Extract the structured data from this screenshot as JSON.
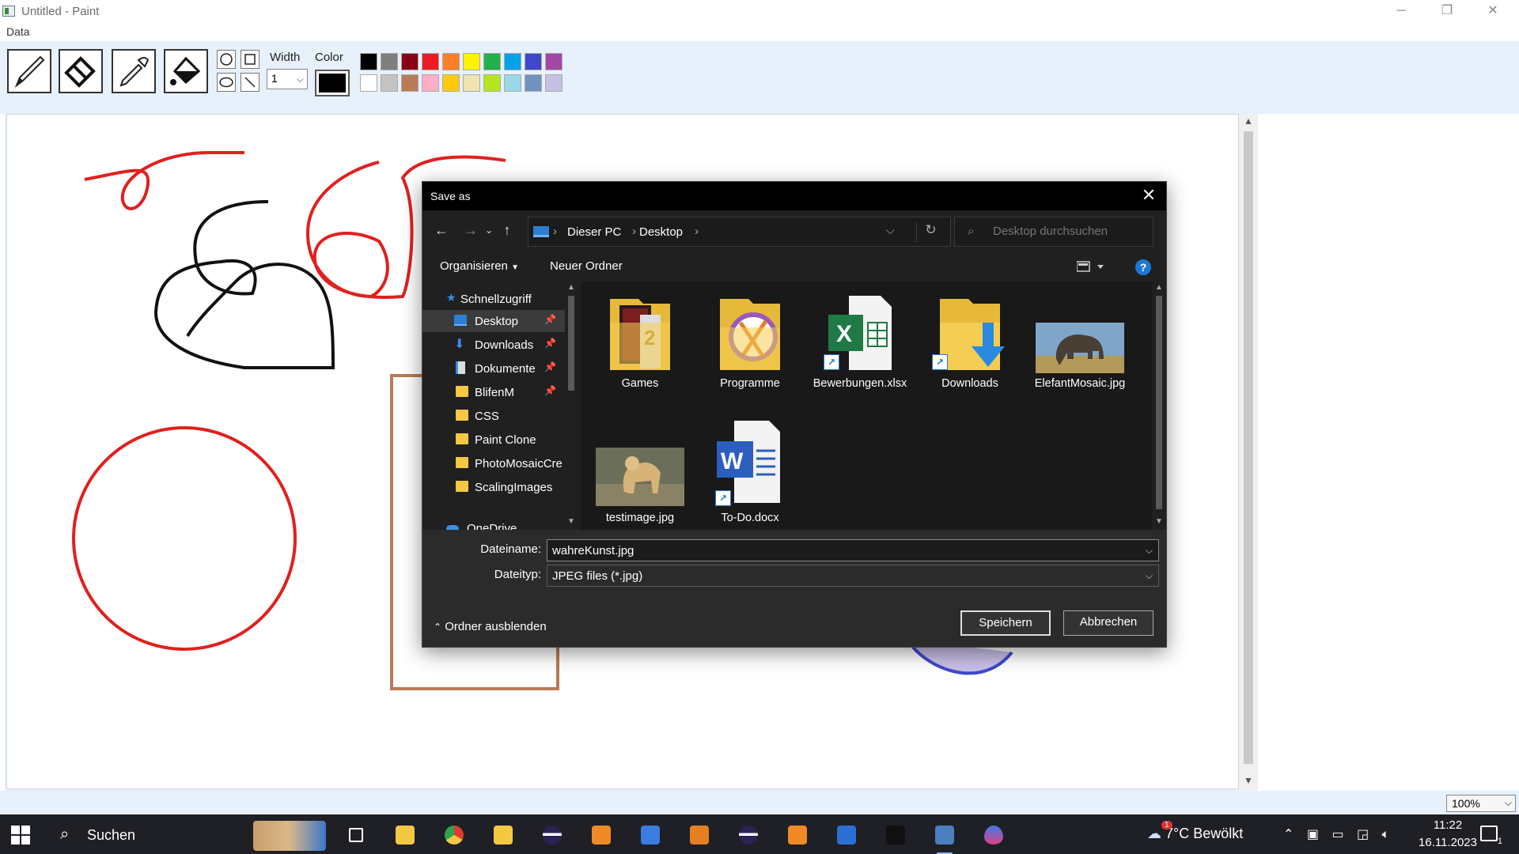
{
  "window": {
    "title": "Untitled - Paint",
    "minimize": "─",
    "maximize": "❐",
    "close": "✕"
  },
  "menu": {
    "items": [
      "Data"
    ]
  },
  "toolbar": {
    "tools": [
      "pencil-icon",
      "eraser-icon",
      "eyedropper-icon",
      "fill-bucket-icon"
    ],
    "shapes": [
      "circle-icon",
      "rectangle-icon",
      "ellipse-icon",
      "line-icon"
    ],
    "width_label": "Width",
    "width_value": "1",
    "color_label": "Color",
    "current_color": "#000000",
    "palette_row1": [
      "#000000",
      "#7f7f7f",
      "#880015",
      "#ed1c24",
      "#ff7f27",
      "#fff200",
      "#22b14c",
      "#00a2e8",
      "#3f48cc",
      "#a349a4"
    ],
    "palette_row2": [
      "#ffffff",
      "#c3c3c3",
      "#b97a57",
      "#ffaec9",
      "#ffc90e",
      "#efe4b0",
      "#b5e61d",
      "#99d9ea",
      "#7092be",
      "#c8bfe7"
    ]
  },
  "status": {
    "zoom": "100%"
  },
  "dialog": {
    "title": "Save as",
    "close": "✕",
    "address": {
      "crumbs": [
        "Dieser PC",
        "Desktop"
      ]
    },
    "search_placeholder": "Desktop durchsuchen",
    "organize_label": "Organisieren",
    "new_folder_label": "Neuer Ordner",
    "help_label": "?",
    "nav_items": [
      {
        "label": "Schnellzugriff",
        "icon": "star-icon",
        "pinned": false
      },
      {
        "label": "Desktop",
        "icon": "desktop-icon",
        "pinned": true,
        "selected": true
      },
      {
        "label": "Downloads",
        "icon": "download-arrow-icon",
        "pinned": true
      },
      {
        "label": "Dokumente",
        "icon": "document-icon",
        "pinned": true
      },
      {
        "label": "BlifenM",
        "icon": "folder-icon",
        "pinned": true
      },
      {
        "label": "CSS",
        "icon": "folder-icon",
        "pinned": false
      },
      {
        "label": "Paint Clone",
        "icon": "folder-icon",
        "pinned": false
      },
      {
        "label": "PhotoMosaicCre",
        "icon": "folder-icon",
        "pinned": false
      },
      {
        "label": "ScalingImages",
        "icon": "folder-icon",
        "pinned": false
      },
      {
        "label": "OneDrive",
        "icon": "cloud-icon",
        "pinned": false
      }
    ],
    "files": [
      {
        "name": "Games",
        "icon": "games-folder-icon"
      },
      {
        "name": "Programme",
        "icon": "programs-folder-icon"
      },
      {
        "name": "Bewerbungen.xlsx",
        "icon": "excel-shortcut-icon"
      },
      {
        "name": "Downloads",
        "icon": "downloads-shortcut-icon"
      },
      {
        "name": "ElefantMosaic.jpg",
        "icon": "elephant-thumbnail"
      },
      {
        "name": "testimage.jpg",
        "icon": "dog-thumbnail"
      },
      {
        "name": "To-Do.docx",
        "icon": "word-shortcut-icon"
      }
    ],
    "filename_label": "Dateiname:",
    "filename_value": "wahreKunst.jpg",
    "filetype_label": "Dateityp:",
    "filetype_value": "JPEG files (*.jpg)",
    "hide_folders_label": "Ordner ausblenden",
    "save_label": "Speichern",
    "cancel_label": "Abbrechen"
  },
  "taskbar": {
    "search_label": "Suchen",
    "apps": [
      "task-view-icon",
      "file-explorer-icon",
      "chrome-icon",
      "app-icon",
      "eclipse-icon",
      "app-icon",
      "app-icon",
      "app-icon",
      "eclipse-icon",
      "xampp-icon",
      "intellij-icon",
      "terminal-icon",
      "paint-clone-icon",
      "drop-icon"
    ],
    "weather": "7°C  Bewölkt",
    "weather_badge": "1",
    "time": "11:22",
    "date": "16.11.2023",
    "notification_count": "1"
  }
}
